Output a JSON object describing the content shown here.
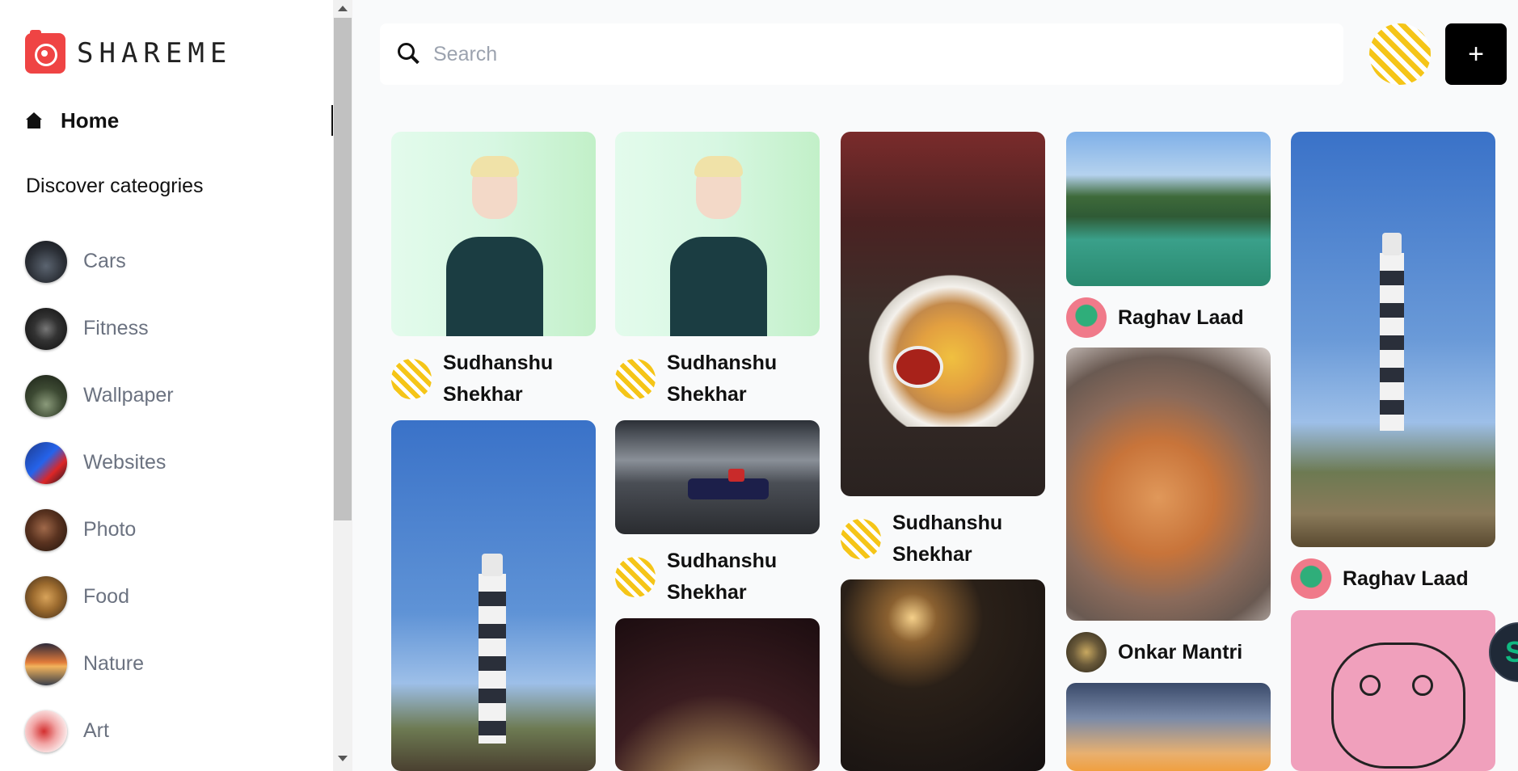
{
  "app": {
    "logo_text": "SHAREME",
    "brand_color": "#ef4444"
  },
  "sidebar": {
    "home_label": "Home",
    "discover_title": "Discover cateogries",
    "categories": [
      {
        "label": "Cars",
        "icon": "cars-thumbnail"
      },
      {
        "label": "Fitness",
        "icon": "fitness-thumbnail"
      },
      {
        "label": "Wallpaper",
        "icon": "wallpaper-thumbnail"
      },
      {
        "label": "Websites",
        "icon": "websites-thumbnail"
      },
      {
        "label": "Photo",
        "icon": "photo-thumbnail"
      },
      {
        "label": "Food",
        "icon": "food-thumbnail"
      },
      {
        "label": "Nature",
        "icon": "nature-thumbnail"
      },
      {
        "label": "Art",
        "icon": "art-thumbnail"
      }
    ]
  },
  "search": {
    "placeholder": "Search",
    "value": ""
  },
  "header": {
    "create_label": "+"
  },
  "pins": [
    {
      "author": "Sudhanshu Shekhar",
      "image": "man-portrait"
    },
    {
      "author": "Sudhanshu Shekhar",
      "image": "man-portrait"
    },
    {
      "author": "Sudhanshu Shekhar",
      "image": "breakfast-plate"
    },
    {
      "author": "Raghav Laad",
      "image": "lake-and-trees"
    },
    {
      "author": "Raghav Laad",
      "image": "lighthouse"
    },
    {
      "author": "",
      "image": "lighthouse"
    },
    {
      "author": "Sudhanshu Shekhar",
      "image": "formula-one-car"
    },
    {
      "author": "Onkar Mantri",
      "image": "orange-kitten"
    },
    {
      "author": "",
      "image": "pocket-watch"
    },
    {
      "author": "",
      "image": "lantern-alley"
    },
    {
      "author": "",
      "image": "sunset-sky"
    },
    {
      "author": "",
      "image": "doodle-art"
    }
  ]
}
